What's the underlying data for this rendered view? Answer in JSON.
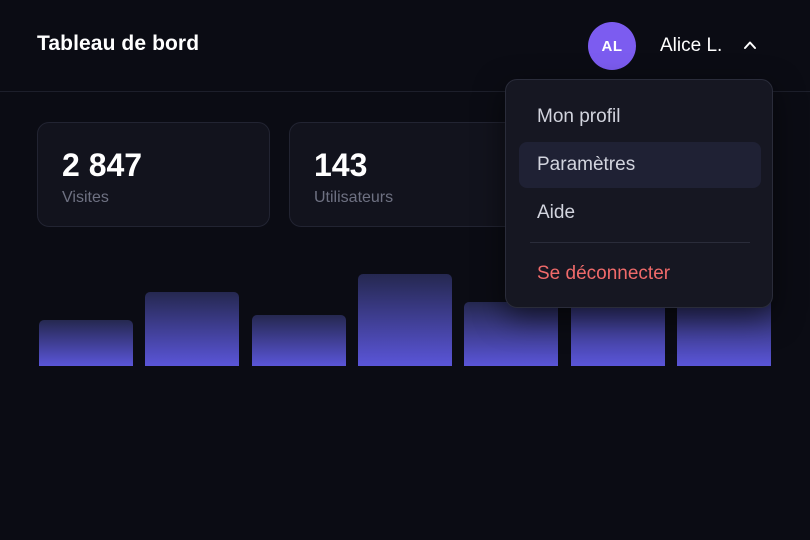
{
  "header": {
    "title": "Tableau de bord",
    "user": {
      "initials": "AL",
      "name": "Alice L.",
      "avatar_color": "#7c5cf0",
      "menu_open": true,
      "chevron_icon": "chevron-up-icon"
    }
  },
  "stats": [
    {
      "value": "2 847",
      "label": "Visites"
    },
    {
      "value": "143",
      "label": "Utilisateurs"
    }
  ],
  "user_menu": {
    "items": [
      {
        "label": "Mon profil"
      },
      {
        "label": "Paramètres",
        "highlighted": true
      },
      {
        "label": "Aide"
      }
    ],
    "logout": {
      "label": "Se déconnecter",
      "color": "#f06a6a"
    }
  },
  "chart_data": {
    "type": "bar",
    "title": "",
    "xlabel": "",
    "ylabel": "",
    "values": [
      43,
      70,
      48,
      87,
      60,
      75,
      68
    ],
    "ylim": [
      0,
      100
    ],
    "grid": false,
    "bar_gradient": [
      "#252850",
      "#5a55d8"
    ]
  }
}
